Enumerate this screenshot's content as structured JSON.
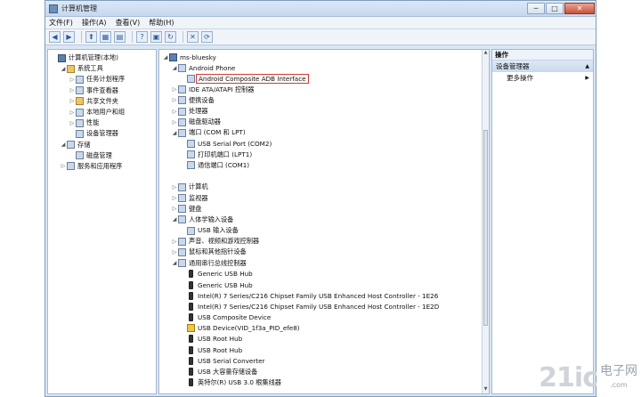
{
  "window": {
    "title": "计算机管理"
  },
  "titlebar_controls": [
    "─",
    "□",
    "✕"
  ],
  "menu": [
    "文件(F)",
    "操作(A)",
    "查看(V)",
    "帮助(H)"
  ],
  "toolbar_icons": [
    "back-icon",
    "forward-icon",
    "up-icon",
    "show-hide-icon",
    "properties-icon",
    "help-icon",
    "tree-icon",
    "update-driver-icon",
    "uninstall-icon",
    "scan-icon"
  ],
  "left_tree": [
    {
      "label": "计算机管理(本地)",
      "indent": 0,
      "exp": "",
      "icon": "pc"
    },
    {
      "label": "系统工具",
      "indent": 1,
      "exp": "◢",
      "icon": "folder"
    },
    {
      "label": "任务计划程序",
      "indent": 2,
      "exp": "▷",
      "icon": ""
    },
    {
      "label": "事件查看器",
      "indent": 2,
      "exp": "▷",
      "icon": ""
    },
    {
      "label": "共享文件夹",
      "indent": 2,
      "exp": "▷",
      "icon": "folder"
    },
    {
      "label": "本地用户和组",
      "indent": 2,
      "exp": "▷",
      "icon": ""
    },
    {
      "label": "性能",
      "indent": 2,
      "exp": "▷",
      "icon": ""
    },
    {
      "label": "设备管理器",
      "indent": 2,
      "exp": "",
      "icon": ""
    },
    {
      "label": "存储",
      "indent": 1,
      "exp": "◢",
      "icon": ""
    },
    {
      "label": "磁盘管理",
      "indent": 2,
      "exp": "",
      "icon": ""
    },
    {
      "label": "服务和应用程序",
      "indent": 1,
      "exp": "▷",
      "icon": ""
    }
  ],
  "device_tree": [
    {
      "label": "ms-bluesky",
      "indent": 0,
      "exp": "◢",
      "icon": "pc"
    },
    {
      "label": "Android Phone",
      "indent": 1,
      "exp": "◢",
      "icon": ""
    },
    {
      "label": "Android Composite ADB Interface",
      "indent": 2,
      "exp": "",
      "icon": "",
      "highlight": true
    },
    {
      "label": "IDE ATA/ATAPI 控制器",
      "indent": 1,
      "exp": "▷",
      "icon": ""
    },
    {
      "label": "便携设备",
      "indent": 1,
      "exp": "▷",
      "icon": ""
    },
    {
      "label": "处理器",
      "indent": 1,
      "exp": "▷",
      "icon": ""
    },
    {
      "label": "磁盘驱动器",
      "indent": 1,
      "exp": "▷",
      "icon": ""
    },
    {
      "label": "端口 (COM 和 LPT)",
      "indent": 1,
      "exp": "◢",
      "icon": ""
    },
    {
      "label": "USB Serial Port (COM2)",
      "indent": 2,
      "exp": "",
      "icon": ""
    },
    {
      "label": "打印机端口 (LPT1)",
      "indent": 2,
      "exp": "",
      "icon": ""
    },
    {
      "label": "通信端口 (COM1)",
      "indent": 2,
      "exp": "",
      "icon": ""
    },
    {
      "label": "",
      "indent": 1,
      "exp": "",
      "icon": "none"
    },
    {
      "label": "计算机",
      "indent": 1,
      "exp": "▷",
      "icon": ""
    },
    {
      "label": "监视器",
      "indent": 1,
      "exp": "▷",
      "icon": ""
    },
    {
      "label": "键盘",
      "indent": 1,
      "exp": "▷",
      "icon": ""
    },
    {
      "label": "人体学输入设备",
      "indent": 1,
      "exp": "◢",
      "icon": ""
    },
    {
      "label": "USB 输入设备",
      "indent": 2,
      "exp": "",
      "icon": ""
    },
    {
      "label": "声音、视频和游戏控制器",
      "indent": 1,
      "exp": "▷",
      "icon": ""
    },
    {
      "label": "鼠标和其他指针设备",
      "indent": 1,
      "exp": "▷",
      "icon": ""
    },
    {
      "label": "通用串行总线控制器",
      "indent": 1,
      "exp": "◢",
      "icon": ""
    },
    {
      "label": "Generic USB Hub",
      "indent": 2,
      "exp": "",
      "icon": "usb"
    },
    {
      "label": "Generic USB Hub",
      "indent": 2,
      "exp": "",
      "icon": "usb"
    },
    {
      "label": "Intel(R) 7 Series/C216 Chipset Family USB Enhanced Host Controller - 1E26",
      "indent": 2,
      "exp": "",
      "icon": "usb"
    },
    {
      "label": "Intel(R) 7 Series/C216 Chipset Family USB Enhanced Host Controller - 1E2D",
      "indent": 2,
      "exp": "",
      "icon": "usb"
    },
    {
      "label": "USB Composite Device",
      "indent": 2,
      "exp": "",
      "icon": "usb"
    },
    {
      "label": "USB Device(VID_1f3a_PID_efe8)",
      "indent": 2,
      "exp": "",
      "icon": "warn"
    },
    {
      "label": "USB Root Hub",
      "indent": 2,
      "exp": "",
      "icon": "usb"
    },
    {
      "label": "USB Root Hub",
      "indent": 2,
      "exp": "",
      "icon": "usb"
    },
    {
      "label": "USB Serial Converter",
      "indent": 2,
      "exp": "",
      "icon": "usb"
    },
    {
      "label": "USB 大容量存储设备",
      "indent": 2,
      "exp": "",
      "icon": "usb"
    },
    {
      "label": "英特尔(R) USB 3.0 根集线器",
      "indent": 2,
      "exp": "",
      "icon": "usb"
    }
  ],
  "actions": {
    "header": "操作",
    "sub": "设备管理器",
    "more": "更多操作"
  },
  "watermark": {
    "logo": "21ic",
    "text": "电子网",
    "sub": ".com"
  }
}
